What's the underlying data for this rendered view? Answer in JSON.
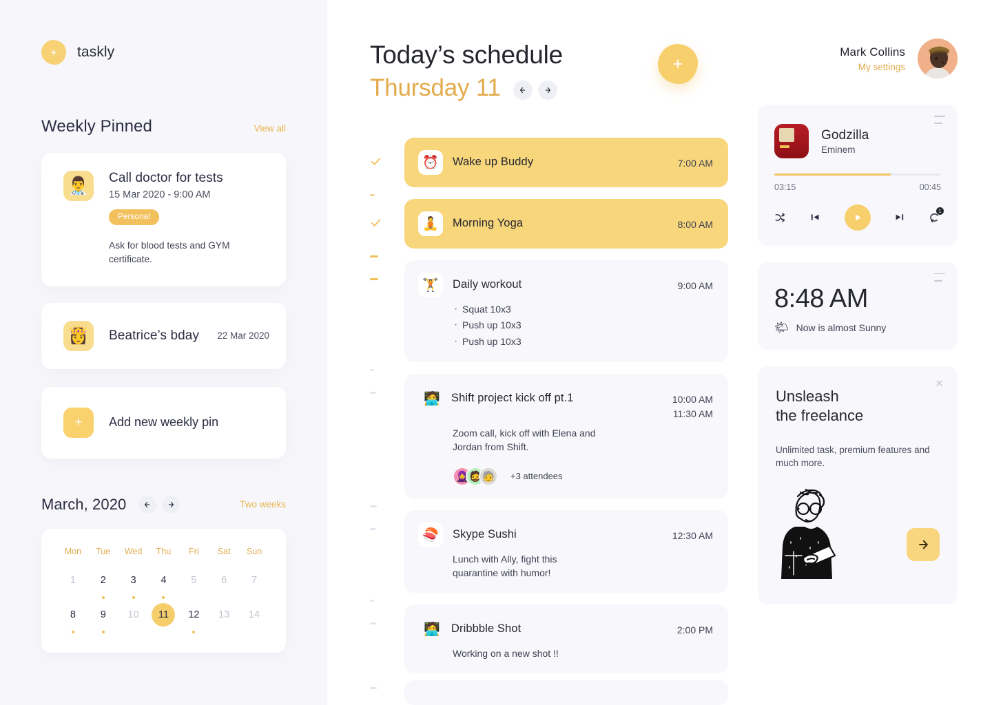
{
  "brand": {
    "name": "taskly",
    "logo_icon": "plus-icon"
  },
  "sidebar": {
    "pinned_section": {
      "title": "Weekly Pinned",
      "view_all": "View all"
    },
    "pins": [
      {
        "emoji": "👨‍⚕️",
        "title": "Call doctor for tests",
        "date": "15 Mar 2020 - 9:00 AM",
        "tag": "Personal",
        "note": "Ask for blood tests and GYM certificate."
      },
      {
        "emoji": "👸",
        "title": "Beatrice’s bday",
        "date": "22 Mar 2020"
      }
    ],
    "add_pin": {
      "label": "Add new weekly pin",
      "icon": "plus-icon"
    },
    "calendar": {
      "title": "March, 2020",
      "prev_icon": "arrow-left-icon",
      "next_icon": "arrow-right-icon",
      "range_toggle": "Two weeks",
      "weekdays": [
        "Mon",
        "Tue",
        "Wed",
        "Thu",
        "Fri",
        "Sat",
        "Sun"
      ],
      "days": [
        {
          "n": "1",
          "muted": true,
          "dot": false,
          "today": false
        },
        {
          "n": "2",
          "muted": false,
          "dot": true,
          "today": false
        },
        {
          "n": "3",
          "muted": false,
          "dot": true,
          "today": false
        },
        {
          "n": "4",
          "muted": false,
          "dot": true,
          "today": false
        },
        {
          "n": "5",
          "muted": true,
          "dot": false,
          "today": false
        },
        {
          "n": "6",
          "muted": true,
          "dot": false,
          "today": false
        },
        {
          "n": "7",
          "muted": true,
          "dot": false,
          "today": false
        },
        {
          "n": "8",
          "muted": false,
          "dot": true,
          "today": false
        },
        {
          "n": "9",
          "muted": false,
          "dot": true,
          "today": false
        },
        {
          "n": "10",
          "muted": true,
          "dot": false,
          "today": false
        },
        {
          "n": "11",
          "muted": false,
          "dot": false,
          "today": true
        },
        {
          "n": "12",
          "muted": false,
          "dot": true,
          "today": false
        },
        {
          "n": "13",
          "muted": true,
          "dot": false,
          "today": false
        },
        {
          "n": "14",
          "muted": true,
          "dot": false,
          "today": false
        }
      ]
    }
  },
  "main": {
    "title": "Today’s schedule",
    "subtitle": "Thursday 11",
    "prev_icon": "arrow-left-icon",
    "next_icon": "arrow-right-icon",
    "add_task_icon": "plus-icon",
    "schedule": [
      {
        "emoji": "⏰",
        "name": "Wake up Buddy",
        "times": [
          "7:00 AM"
        ],
        "done": true,
        "mark": "check"
      },
      {
        "emoji": "🧘",
        "name": "Morning Yoga",
        "times": [
          "8:00 AM"
        ],
        "done": true,
        "mark": "check"
      },
      {
        "emoji": "🏋️",
        "name": "Daily workout",
        "times": [
          "9:00 AM"
        ],
        "done": false,
        "mark": "dash-strong",
        "bullets": [
          "Squat 10x3",
          "Push up 10x3",
          "Push up 10x3"
        ]
      },
      {
        "emoji": "🧑‍💻",
        "name": "Shift project kick off pt.1",
        "times": [
          "10:00 AM",
          "11:30 AM"
        ],
        "done": false,
        "mark": "dash",
        "desc": "Zoom call, kick off with Elena and Jordan from Shift.",
        "attendees": [
          "🧕",
          "🧔",
          "🧓"
        ],
        "attendee_count": "+3 attendees"
      },
      {
        "emoji": "🍣",
        "name": "Skype Sushi",
        "times": [
          "12:30 AM"
        ],
        "done": false,
        "mark": "dash",
        "desc": "Lunch with Ally, fight this quarantine with humor!"
      },
      {
        "emoji": "🧑‍💻",
        "name": "Dribbble Shot",
        "times": [
          "2:00 PM"
        ],
        "done": false,
        "mark": "dash",
        "desc": "Working on a new shot !!"
      }
    ]
  },
  "right": {
    "user": {
      "name": "Mark Collins",
      "settings_link": "My settings",
      "avatar_icon": "avatar"
    },
    "player": {
      "track": "Godzilla",
      "artist": "Eminem",
      "elapsed": "03:15",
      "remaining": "00:45",
      "progress_percent": 70,
      "menu_icon": "menu-icon",
      "shuffle_icon": "shuffle-icon",
      "prev_icon": "previous-track-icon",
      "play_icon": "play-icon",
      "next_icon": "next-track-icon",
      "repeat_icon": "repeat-icon",
      "repeat_badge": "1"
    },
    "clock": {
      "time": "8:48 AM",
      "weather_emoji": "🌤",
      "weather_text": "Now is almost Sunny",
      "menu_icon": "menu-icon"
    },
    "promo": {
      "title_line1": "Unsleash",
      "title_line2": "the freelance",
      "subtitle": "Unlimited task, premium features and much more.",
      "close_icon": "close-icon",
      "cta_icon": "arrow-right-icon"
    }
  },
  "colors": {
    "accent": "#f7cf6d",
    "accent_text": "#e0ab4d",
    "card_bg": "#f8f8fc",
    "panel_bg": "#f7f7fb",
    "text": "#25272f"
  }
}
